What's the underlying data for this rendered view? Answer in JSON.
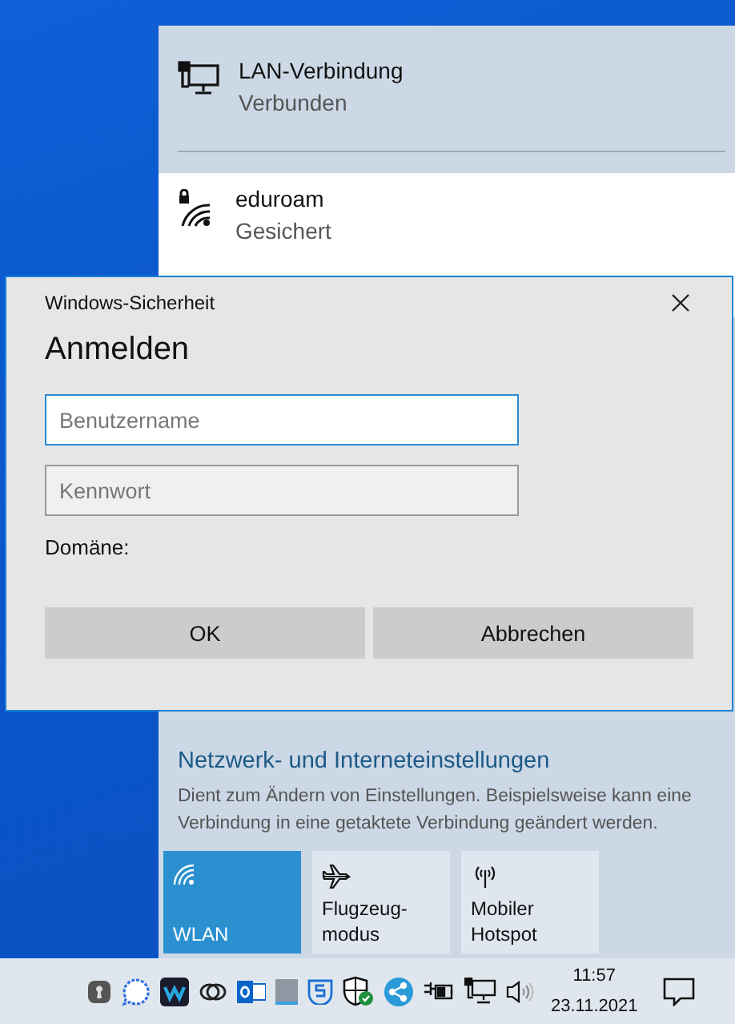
{
  "networks": [
    {
      "name": "LAN-Verbindung",
      "status": "Verbunden",
      "kind": "ethernet",
      "connected": true
    },
    {
      "name": "eduroam",
      "status": "Gesichert",
      "kind": "wifi",
      "connected": false
    }
  ],
  "dialog": {
    "title": "Windows-Sicherheit",
    "heading": "Anmelden",
    "fields": [
      {
        "placeholder": "Benutzername",
        "focused": true
      },
      {
        "placeholder": "Kennwort",
        "focused": false
      }
    ],
    "domain_label": "Domäne:",
    "buttons": [
      "OK",
      "Abbrechen"
    ]
  },
  "settings": {
    "title": "Netzwerk- und Interneteinstellungen",
    "description": "Dient zum Ändern von Einstellungen. Beispielsweise kann eine Verbindung in eine getaktete Verbindung geändert werden."
  },
  "tiles": [
    {
      "label": "WLAN",
      "kind": "wifi",
      "on": true
    },
    {
      "label": "Flugzeug-modus",
      "kind": "airplane",
      "on": false
    },
    {
      "label": "Mobiler Hotspot",
      "kind": "hotspot",
      "on": false
    }
  ],
  "taskbar": {
    "time": "11:57",
    "date": "23.11.2021"
  }
}
